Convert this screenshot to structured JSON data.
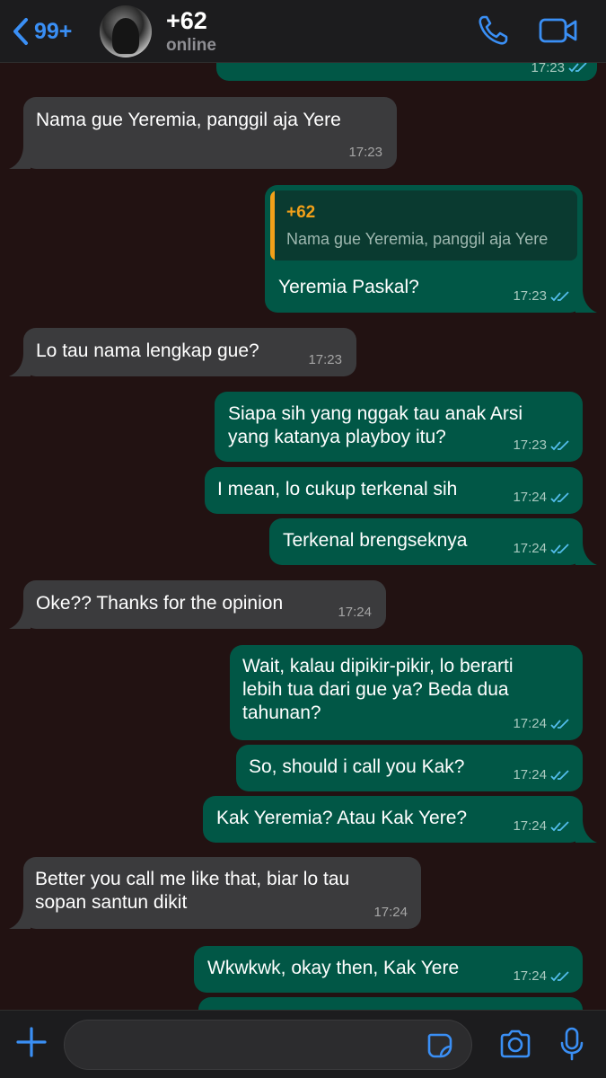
{
  "header": {
    "back_count": "99+",
    "contact_name": "+62",
    "contact_status": "online"
  },
  "messages": [
    {
      "dir": "in",
      "text": "Nama gue Yeremia, panggil aja Yere",
      "time": "17:23"
    },
    {
      "dir": "out",
      "quote_name": "+62",
      "quote_text": "Nama gue Yeremia, panggil aja Yere",
      "text": "Yeremia Paskal?",
      "time": "17:23"
    },
    {
      "dir": "in",
      "text": "Lo tau nama lengkap gue?",
      "time": "17:23"
    },
    {
      "dir": "out",
      "line1": "Siapa sih yang nggak tau anak Arsi",
      "line2": "yang katanya playboy itu?",
      "time": "17:23"
    },
    {
      "dir": "out",
      "text": "I mean, lo cukup terkenal sih",
      "time": "17:24"
    },
    {
      "dir": "out",
      "text": "Terkenal brengseknya",
      "time": "17:24"
    },
    {
      "dir": "in",
      "text": "Oke?? Thanks for the opinion",
      "time": "17:24"
    },
    {
      "dir": "out",
      "line1": "Wait, kalau dipikir-pikir, lo berarti",
      "line2": "lebih tua dari gue ya? Beda dua",
      "line3": "tahunan?",
      "time": "17:24"
    },
    {
      "dir": "out",
      "text": "So, should i call you Kak?",
      "time": "17:24"
    },
    {
      "dir": "out",
      "text": "Kak Yeremia? Atau Kak Yere?",
      "time": "17:24"
    },
    {
      "dir": "in",
      "line1": "Better you call me like that, biar lo tau",
      "line2": "sopan santun dikit",
      "time": "17:24"
    },
    {
      "dir": "out",
      "text": "Wkwkwk, okay then, Kak Yere",
      "time": "17:24"
    }
  ],
  "partial_top": {
    "time": "17:23"
  },
  "composer": {
    "placeholder": ""
  },
  "colors": {
    "accent": "#3a8ff5",
    "incoming": "#3b3b3d",
    "outgoing": "#015746",
    "background": "#221212",
    "quote": "#f2a019"
  }
}
